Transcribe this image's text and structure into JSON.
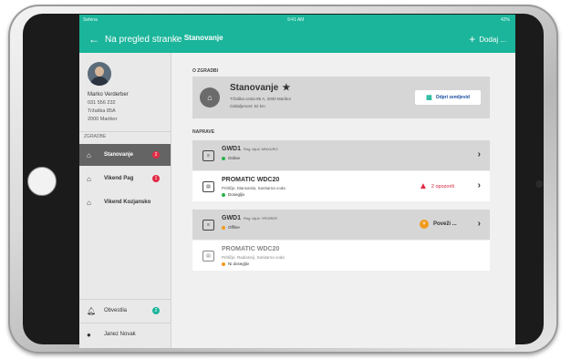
{
  "status_bar": {
    "carrier": "Sefena",
    "time": "9:41 AM",
    "battery": "42%"
  },
  "nav": {
    "back_label": "Na pregled stranke",
    "title": "Stanovanje",
    "add_label": "Dodaj ..."
  },
  "sidebar": {
    "user": {
      "name": "Marko Verderber",
      "phone": "031 556 232",
      "street": "Tržaška 85A",
      "city": "2000 Maribor"
    },
    "section_label": "ZGRADBE",
    "items": [
      {
        "label": "Stanovanje",
        "badge": "2"
      },
      {
        "label": "Vikend Pag",
        "badge": "1"
      },
      {
        "label": "Vikend Kozjansko"
      }
    ],
    "bottom": [
      {
        "label": "Obvestila",
        "badge": "2"
      },
      {
        "label": "Janez Novak"
      }
    ]
  },
  "building": {
    "section_title": "O ZGRADBI",
    "name": "Stanovanje",
    "address": "Tržaška cesta 85 A, 2000 Maribor",
    "distance": "Oddaljenost: 52 km",
    "map_button": "Odpri zemljevid"
  },
  "devices": {
    "section_title": "NAPRAVE",
    "list": [
      {
        "name": "GWD1",
        "reg": "Reg. ključ: MNXURO",
        "status": "Online",
        "status_color": "#2bb24c"
      },
      {
        "name": "PROMATIC WDC20",
        "desc": "Pritličje, Mansarda, Sanitarna voda",
        "status": "Dosegljiv",
        "status_color": "#2bb24c",
        "alert": "2 opozorili"
      },
      {
        "name": "GWD1",
        "reg": "Reg. ključ: YRORER",
        "status": "Offline",
        "status_color": "#f19a1c",
        "action": "Poveži ..."
      },
      {
        "name": "PROMATIC WDC20",
        "desc": "Pritličje, Radiatorji, Sanitarna voda",
        "status": "Ni dosegljiv",
        "status_color": "#f19a1c"
      }
    ]
  },
  "colors": {
    "accent": "#1bb59b",
    "alert": "#e22b45",
    "warning": "#f19a1c"
  }
}
